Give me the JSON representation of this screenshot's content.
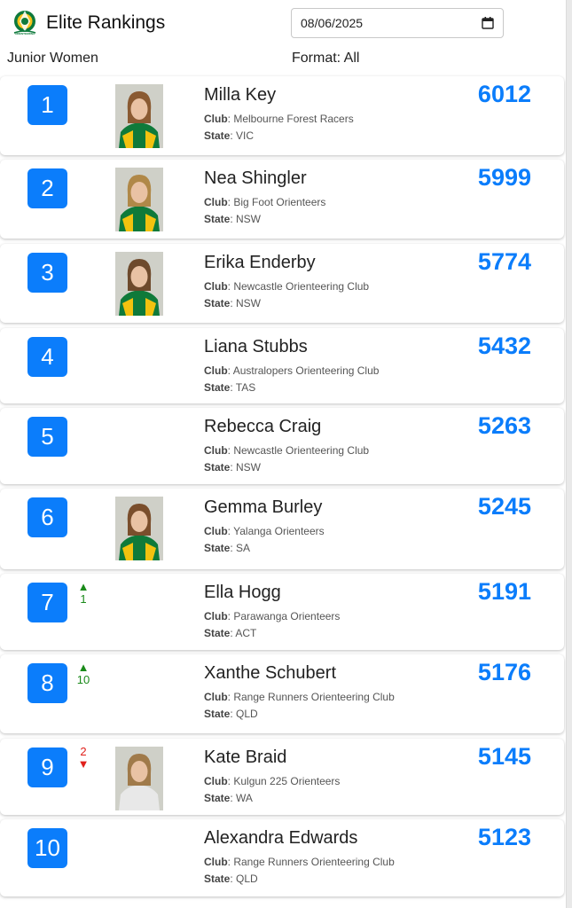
{
  "header": {
    "title": "Elite Rankings",
    "logo_text": "ORIENTEERING",
    "category": "Junior Women",
    "date_value": "08/06/2025",
    "format_text": "Format: All"
  },
  "labels": {
    "club": "Club",
    "state": "State"
  },
  "athletes": [
    {
      "rank": "1",
      "name": "Milla Key",
      "club": "Melbourne Forest Racers",
      "state": "VIC",
      "score": "6012",
      "movement": "",
      "direction": "",
      "photo": true,
      "hair": "#8a5a32",
      "jacket": "#0f7a3a"
    },
    {
      "rank": "2",
      "name": "Nea Shingler",
      "club": "Big Foot Orienteers",
      "state": "NSW",
      "score": "5999",
      "movement": "",
      "direction": "",
      "photo": true,
      "hair": "#b08848",
      "jacket": "#0f7a3a"
    },
    {
      "rank": "3",
      "name": "Erika Enderby",
      "club": "Newcastle Orienteering Club",
      "state": "NSW",
      "score": "5774",
      "movement": "",
      "direction": "",
      "photo": true,
      "hair": "#6e4a2c",
      "jacket": "#0f7a3a"
    },
    {
      "rank": "4",
      "name": "Liana Stubbs",
      "club": "Australopers Orienteering Club",
      "state": "TAS",
      "score": "5432",
      "movement": "",
      "direction": "",
      "photo": false
    },
    {
      "rank": "5",
      "name": "Rebecca Craig",
      "club": "Newcastle Orienteering Club",
      "state": "NSW",
      "score": "5263",
      "movement": "",
      "direction": "",
      "photo": false
    },
    {
      "rank": "6",
      "name": "Gemma Burley",
      "club": "Yalanga Orienteers",
      "state": "SA",
      "score": "5245",
      "movement": "",
      "direction": "",
      "photo": true,
      "hair": "#7a4e2c",
      "jacket": "#0f7a3a"
    },
    {
      "rank": "7",
      "name": "Ella Hogg",
      "club": "Parawanga Orienteers",
      "state": "ACT",
      "score": "5191",
      "movement": "1",
      "direction": "up",
      "photo": false
    },
    {
      "rank": "8",
      "name": "Xanthe Schubert",
      "club": "Range Runners Orienteering Club",
      "state": "QLD",
      "score": "5176",
      "movement": "10",
      "direction": "up",
      "photo": false
    },
    {
      "rank": "9",
      "name": "Kate Braid",
      "club": "Kulgun 225 Orienteers",
      "state": "WA",
      "score": "5145",
      "movement": "2",
      "direction": "down",
      "photo": true,
      "hair": "#a07a4a",
      "jacket": "#e8e8e8"
    },
    {
      "rank": "10",
      "name": "Alexandra Edwards",
      "club": "Range Runners Orienteering Club",
      "state": "QLD",
      "score": "5123",
      "movement": "",
      "direction": "",
      "photo": false
    }
  ],
  "icons": {
    "calendar": "calendar-icon",
    "up_arrow": "triangle-up-icon",
    "down_arrow": "triangle-down-icon"
  },
  "colors": {
    "accent": "#0b7dfb",
    "up": "#1a8a1a",
    "down": "#e0201b"
  }
}
